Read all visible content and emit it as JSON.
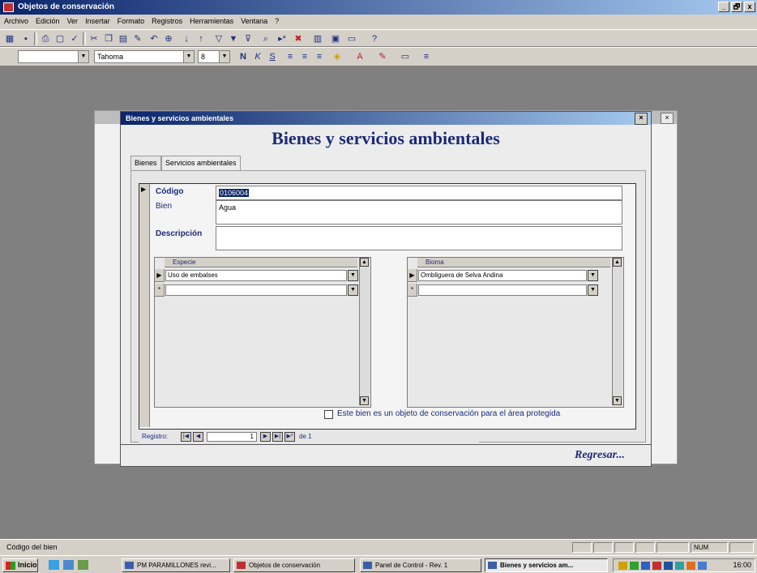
{
  "app": {
    "title": "Objetos de conservación",
    "controls": [
      "_",
      "🗗",
      "x"
    ]
  },
  "menu": [
    "Archivo",
    "Edición",
    "Ver",
    "Insertar",
    "Formato",
    "Registros",
    "Herramientas",
    "Ventana",
    "?"
  ],
  "format_toolbar": {
    "object_combo": "",
    "font_combo": "Tahoma",
    "size_combo": "8"
  },
  "form": {
    "window_title": "Bienes y servicios ambientales",
    "header": "Bienes y servicios ambientales",
    "tabs": [
      "Bienes",
      "Servicios ambientales"
    ],
    "fields": {
      "codigo_label": "Código",
      "codigo_value": "0106004",
      "bien_label": "Bien",
      "bien_value": "Agua",
      "descripcion_label": "Descripción",
      "descripcion_value": ""
    },
    "especie_grid": {
      "header": "Especie",
      "rows": [
        "Uso de embalses",
        ""
      ]
    },
    "bioma_grid": {
      "header": "Bioma",
      "rows": [
        "Ombliguera de Selva Andina",
        ""
      ]
    },
    "checkbox_label": "Este bien es un objeto de conservación para el área protegida",
    "checkbox_checked": false,
    "navigation": {
      "label": "Registro:",
      "current": "1",
      "of_text": "de 1"
    },
    "return_button": "Regresar..."
  },
  "status": {
    "message": "Código del bien",
    "indicator": "NUM"
  },
  "taskbar": {
    "start": "Inicio",
    "tasks": [
      "PM PARAMILLONES revi...",
      "Objetos de conservación",
      "Panel de Control - Rev. 1",
      "Bienes y servicios am..."
    ],
    "clock": "16:00"
  }
}
